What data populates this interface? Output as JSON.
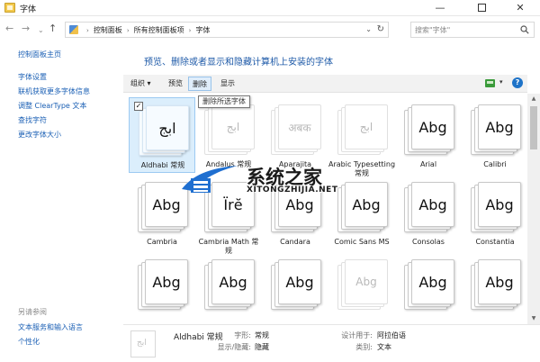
{
  "window": {
    "title": "字体",
    "minimize": "—",
    "close": "✕"
  },
  "nav": {
    "back": "←",
    "forward": "→",
    "history": "⌄",
    "up": "↑"
  },
  "breadcrumbs": [
    "控制面板",
    "所有控制面板项",
    "字体"
  ],
  "address": {
    "separator": "›",
    "dropdown": "⌄",
    "refresh": "↻"
  },
  "search": {
    "placeholder": "搜索\"字体\""
  },
  "sidebar": {
    "items": [
      "控制面板主页",
      "字体设置",
      "联机获取更多字体信息",
      "调整 ClearType 文本",
      "查找字符",
      "更改字体大小"
    ],
    "see_also": "另请参阅",
    "see_also_items": [
      "文本服务和输入语言",
      "个性化"
    ]
  },
  "main": {
    "heading": "预览、删除或者显示和隐藏计算机上安装的字体"
  },
  "toolbar": {
    "organize": "组织 ▾",
    "preview": "预览",
    "delete": "删除",
    "show": "显示",
    "view_dropdown": "▾",
    "help": "?"
  },
  "tooltip": "删除所选字体",
  "fonts": [
    {
      "name": "Aldhabi 常规",
      "sample": "ابج",
      "style": "selected",
      "checked": "✓"
    },
    {
      "name": "Andalus 常规",
      "sample": "ابج",
      "style": "faded"
    },
    {
      "name": "Aparajita",
      "sample": "अबक",
      "style": "faded"
    },
    {
      "name": "Arabic Typesetting 常规",
      "sample": "ابج",
      "style": "faded"
    },
    {
      "name": "Arial",
      "sample": "Abg",
      "style": "normal"
    },
    {
      "name": "Calibri",
      "sample": "Abg",
      "style": "normal"
    },
    {
      "name": "Cambria",
      "sample": "Abg",
      "style": "normal"
    },
    {
      "name": "Cambria Math 常规",
      "sample": "Ïrĕ",
      "style": "normal"
    },
    {
      "name": "Candara",
      "sample": "Abg",
      "style": "normal"
    },
    {
      "name": "Comic Sans MS",
      "sample": "Abg",
      "style": "normal"
    },
    {
      "name": "Consolas",
      "sample": "Abg",
      "style": "normal"
    },
    {
      "name": "Constantia",
      "sample": "Abg",
      "style": "normal"
    },
    {
      "name": "",
      "sample": "Abg",
      "style": "normal"
    },
    {
      "name": "",
      "sample": "Abg",
      "style": "normal"
    },
    {
      "name": "",
      "sample": "Abg",
      "style": "normal"
    },
    {
      "name": "",
      "sample": "Abg",
      "style": "faded"
    },
    {
      "name": "",
      "sample": "Abg",
      "style": "normal"
    },
    {
      "name": "",
      "sample": "Abg",
      "style": "normal"
    }
  ],
  "details": {
    "icon_sample": "ابج",
    "name": "Aldhabi 常规",
    "style_label": "字形:",
    "style_value": "常规",
    "visibility_label": "显示/隐藏:",
    "visibility_value": "隐藏",
    "designed_for_label": "设计用于:",
    "designed_for_value": "阿拉伯语",
    "category_label": "类别:",
    "category_value": "文本"
  },
  "scrollbar": {
    "up": "▲",
    "down": "▼"
  },
  "watermark": {
    "title": "系统之家",
    "url": "XITONGZHIJIA.NET"
  },
  "colors": {
    "link": "#1a5fb4",
    "heading": "#1e5aa8",
    "selected_bg": "#dbeefc"
  }
}
